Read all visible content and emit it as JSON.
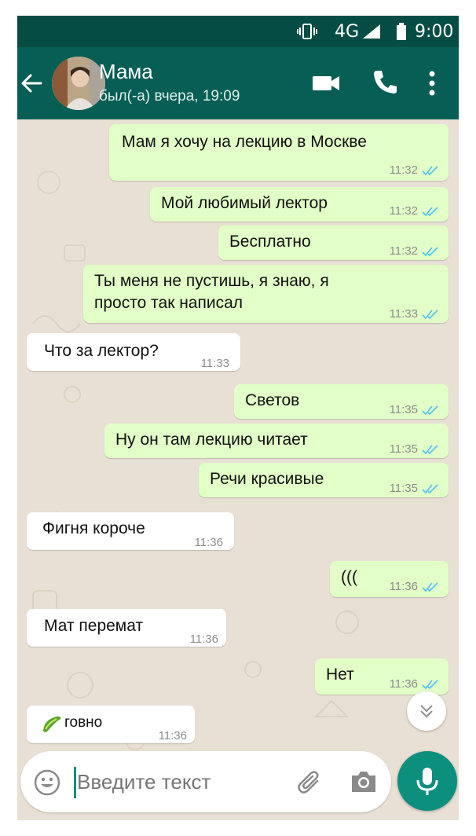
{
  "status_bar": {
    "network": "4G",
    "time": "9:00"
  },
  "chat_header": {
    "contact_name": "Мама",
    "last_seen": "был(-а) вчера, 19:09"
  },
  "messages": [
    {
      "dir": "out",
      "text": "Мам я хочу на лекцию в Москве",
      "time": "11:32"
    },
    {
      "dir": "out",
      "text": "Мой любимый лектор",
      "time": "11:32"
    },
    {
      "dir": "out",
      "text": "Бесплатно",
      "time": "11:32"
    },
    {
      "dir": "out",
      "lines": [
        "Ты меня не пустишь, я знаю, я",
        "просто так написал"
      ],
      "time": "11:33"
    },
    {
      "dir": "in",
      "text": "Что за лектор?",
      "time": "11:33"
    },
    {
      "dir": "out",
      "text": "Светов",
      "time": "11:35"
    },
    {
      "dir": "out",
      "text": "Ну он там лекцию читает",
      "time": "11:35"
    },
    {
      "dir": "out",
      "text": "Речи красивые",
      "time": "11:35"
    },
    {
      "dir": "in",
      "text": "Фигня короче",
      "time": "11:36"
    },
    {
      "dir": "out",
      "text": "(((",
      "time": "11:36"
    },
    {
      "dir": "in",
      "text": "Мат перемат",
      "time": "11:36"
    },
    {
      "dir": "out",
      "text": "Нет",
      "time": "11:36"
    },
    {
      "dir": "in",
      "text": "говно",
      "time": "11:36",
      "emoji": "cucumber-emoji"
    }
  ],
  "composer": {
    "placeholder": "Введите текст"
  },
  "icons": {
    "back": "arrow-left-icon",
    "video": "video-call-icon",
    "call": "phone-icon",
    "menu": "more-vert-icon",
    "emoji": "emoji-icon",
    "attach": "paperclip-icon",
    "camera": "camera-icon",
    "mic": "mic-icon",
    "scroll": "chevron-double-down-icon"
  },
  "colors": {
    "header": "#075e54",
    "status_bar": "#054d44",
    "outgoing_bubble": "#e1ffc7",
    "incoming_bubble": "#ffffff",
    "read_ticks": "#4fc3f7",
    "mic_button": "#0d8f7e",
    "wallpaper": "#e8e0d4"
  }
}
